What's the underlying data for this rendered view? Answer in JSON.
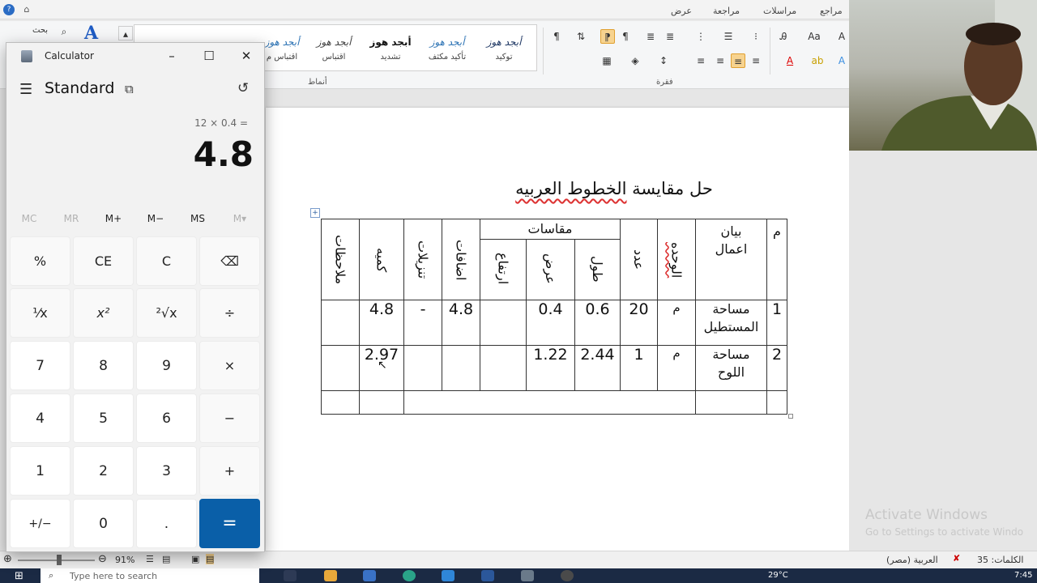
{
  "word": {
    "ribbon_tabs": [
      "مراجع",
      "مراسلات",
      "مراجعة",
      "عرض"
    ],
    "search_label": "بحث",
    "styles": [
      {
        "sample": "أبجد هوز",
        "name": "توكيد"
      },
      {
        "sample": "أبجد هوز",
        "name": "تأكيد مكثف"
      },
      {
        "sample": "أبجد هوز",
        "name": "تشديد"
      },
      {
        "sample": "أبجد هوز",
        "name": "اقتباس"
      },
      {
        "sample": "أبجد هوز",
        "name": "اقتباس م"
      }
    ],
    "group_styles": "أنماط",
    "group_paragraph": "فقرة",
    "document": {
      "title_prefix": "حل مقايسة ",
      "title_underlined": "الخطوط العربيه",
      "table": {
        "header_no": "م",
        "header_desc": "بيان اعمال",
        "header_unit": "الوحده",
        "header_count": "عدد",
        "header_dims": "مقاسات",
        "header_length": "طول",
        "header_width": "عرض",
        "header_height": "ارتفاع",
        "header_additions": "اضافات",
        "header_deductions": "تنزيلات",
        "header_qty": "كميه",
        "header_notes": "ملاحظات",
        "rows": [
          {
            "no": "1",
            "desc": "مساحة المستطيل",
            "unit": "م",
            "count": "20",
            "length": "0.6",
            "width": "0.4",
            "height": "",
            "additions": "4.8",
            "deductions": "-",
            "qty": "4.8",
            "notes": ""
          },
          {
            "no": "2",
            "desc": "مساحة اللوح",
            "unit": "م",
            "count": "1",
            "length": "2.44",
            "width": "1.22",
            "height": "",
            "additions": "",
            "deductions": "",
            "qty": "2.97",
            "notes": ""
          }
        ]
      }
    },
    "watermark": {
      "line1": "Activate Windows",
      "line2": "Go to Settings to activate Windo"
    },
    "status": {
      "words": "الكلمات: 35",
      "language": "العربية (مصر)",
      "zoom": "91%"
    },
    "taskbar": {
      "search_placeholder": "Type here to search",
      "weather": "29°C",
      "time": "7:45"
    }
  },
  "calculator": {
    "title": "Calculator",
    "mode": "Standard",
    "expression": "12 × 0.4 =",
    "display": "4.8",
    "memory": [
      {
        "label": "MC",
        "enabled": false
      },
      {
        "label": "MR",
        "enabled": false
      },
      {
        "label": "M+",
        "enabled": true
      },
      {
        "label": "M−",
        "enabled": true
      },
      {
        "label": "MS",
        "enabled": true
      },
      {
        "label": "M▾",
        "enabled": false
      }
    ],
    "keys": [
      [
        "%",
        "CE",
        "C",
        "⌫"
      ],
      [
        "¹⁄x",
        "x²",
        "²√x",
        "÷"
      ],
      [
        "7",
        "8",
        "9",
        "×"
      ],
      [
        "4",
        "5",
        "6",
        "−"
      ],
      [
        "1",
        "2",
        "3",
        "+"
      ],
      [
        "+/−",
        "0",
        ".",
        "="
      ]
    ],
    "accent_color": "#0a5fa8"
  }
}
